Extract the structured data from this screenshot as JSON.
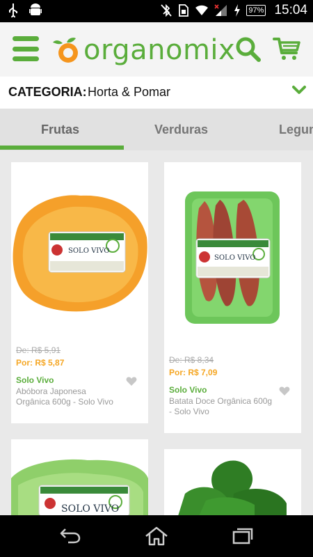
{
  "status": {
    "time": "15:04",
    "battery": "97%",
    "icons": [
      "usb-icon",
      "android-icon",
      "bluetooth-off-icon",
      "sim-icon",
      "wifi-icon",
      "signal-icon",
      "charging-icon"
    ]
  },
  "app": {
    "logo_text": "organomix",
    "accent": "#5aad3b"
  },
  "category": {
    "label": "CATEGORIA:",
    "value": "Horta & Pomar"
  },
  "tabs": [
    {
      "label": "Frutas"
    },
    {
      "label": "Verduras"
    },
    {
      "label": "Legumes"
    }
  ],
  "products": [
    {
      "old_price": "De: R$ 5,91",
      "price": "Por: R$ 5,87",
      "brand": "Solo Vivo",
      "name": "Abóbora Japonesa Orgânica 600g - Solo Vivo"
    },
    {
      "old_price": "De: R$ 8,34",
      "price": "Por: R$ 7,09",
      "brand": "Solo Vivo",
      "name": "Batata Doce Orgânica 600g - Solo Vivo"
    },
    {
      "label_brand": "SOLO VIVO"
    },
    {}
  ],
  "product_label_text": "SOLO VIVO"
}
